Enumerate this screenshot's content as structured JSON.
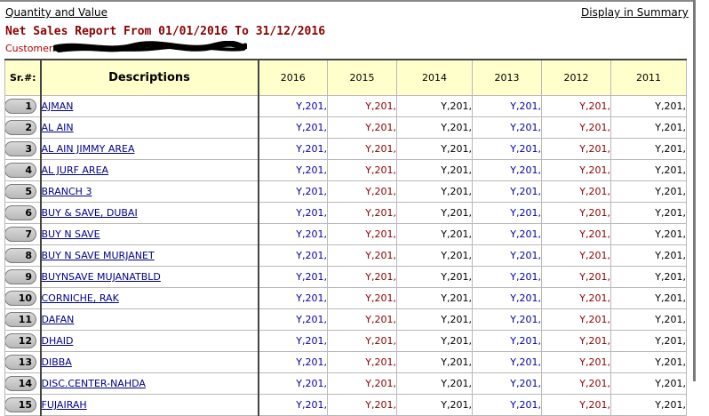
{
  "links": {
    "quantity_value": "Quantity and Value",
    "display_summary": "Display in Summary"
  },
  "report": {
    "title": "Net Sales Report From 01/01/2016 To 31/12/2016",
    "customer_label": "Customer.."
  },
  "table": {
    "headers": {
      "sr": "Sr.#:",
      "desc": "Descriptions",
      "years": [
        "2016",
        "2015",
        "2014",
        "2013",
        "2012",
        "2011"
      ]
    },
    "value_colors": [
      "#0000aa",
      "#8b0000",
      "#000000",
      "#0000aa",
      "#8b0000",
      "#000000"
    ],
    "rows": [
      {
        "sr": "1",
        "desc": "AJMAN",
        "values": [
          "Y,201,",
          "Y,201,",
          "Y,201,",
          "Y,201,",
          "Y,201,",
          "Y,201,"
        ]
      },
      {
        "sr": "2",
        "desc": "AL AIN",
        "values": [
          "Y,201,",
          "Y,201,",
          "Y,201,",
          "Y,201,",
          "Y,201,",
          "Y,201,"
        ]
      },
      {
        "sr": "3",
        "desc": "AL AIN JIMMY AREA",
        "values": [
          "Y,201,",
          "Y,201,",
          "Y,201,",
          "Y,201,",
          "Y,201,",
          "Y,201,"
        ]
      },
      {
        "sr": "4",
        "desc": "AL JURF AREA",
        "values": [
          "Y,201,",
          "Y,201,",
          "Y,201,",
          "Y,201,",
          "Y,201,",
          "Y,201,"
        ]
      },
      {
        "sr": "5",
        "desc": "BRANCH 3",
        "values": [
          "Y,201,",
          "Y,201,",
          "Y,201,",
          "Y,201,",
          "Y,201,",
          "Y,201,"
        ]
      },
      {
        "sr": "6",
        "desc": "BUY & SAVE, DUBAI",
        "values": [
          "Y,201,",
          "Y,201,",
          "Y,201,",
          "Y,201,",
          "Y,201,",
          "Y,201,"
        ]
      },
      {
        "sr": "7",
        "desc": "BUY N SAVE",
        "values": [
          "Y,201,",
          "Y,201,",
          "Y,201,",
          "Y,201,",
          "Y,201,",
          "Y,201,"
        ]
      },
      {
        "sr": "8",
        "desc": "BUY N SAVE MURJANET",
        "values": [
          "Y,201,",
          "Y,201,",
          "Y,201,",
          "Y,201,",
          "Y,201,",
          "Y,201,"
        ]
      },
      {
        "sr": "9",
        "desc": "BUYNSAVE MUJANATBLD",
        "values": [
          "Y,201,",
          "Y,201,",
          "Y,201,",
          "Y,201,",
          "Y,201,",
          "Y,201,"
        ]
      },
      {
        "sr": "10",
        "desc": "CORNICHE, RAK",
        "values": [
          "Y,201,",
          "Y,201,",
          "Y,201,",
          "Y,201,",
          "Y,201,",
          "Y,201,"
        ]
      },
      {
        "sr": "11",
        "desc": "DAFAN",
        "values": [
          "Y,201,",
          "Y,201,",
          "Y,201,",
          "Y,201,",
          "Y,201,",
          "Y,201,"
        ]
      },
      {
        "sr": "12",
        "desc": "DHAID",
        "values": [
          "Y,201,",
          "Y,201,",
          "Y,201,",
          "Y,201,",
          "Y,201,",
          "Y,201,"
        ]
      },
      {
        "sr": "13",
        "desc": "DIBBA",
        "values": [
          "Y,201,",
          "Y,201,",
          "Y,201,",
          "Y,201,",
          "Y,201,",
          "Y,201,"
        ]
      },
      {
        "sr": "14",
        "desc": "DISC.CENTER-NAHDA",
        "values": [
          "Y,201,",
          "Y,201,",
          "Y,201,",
          "Y,201,",
          "Y,201,",
          "Y,201,"
        ]
      },
      {
        "sr": "15",
        "desc": "FUJAIRAH",
        "values": [
          "Y,201,",
          "Y,201,",
          "Y,201,",
          "Y,201,",
          "Y,201,",
          "Y,201,"
        ]
      }
    ]
  }
}
